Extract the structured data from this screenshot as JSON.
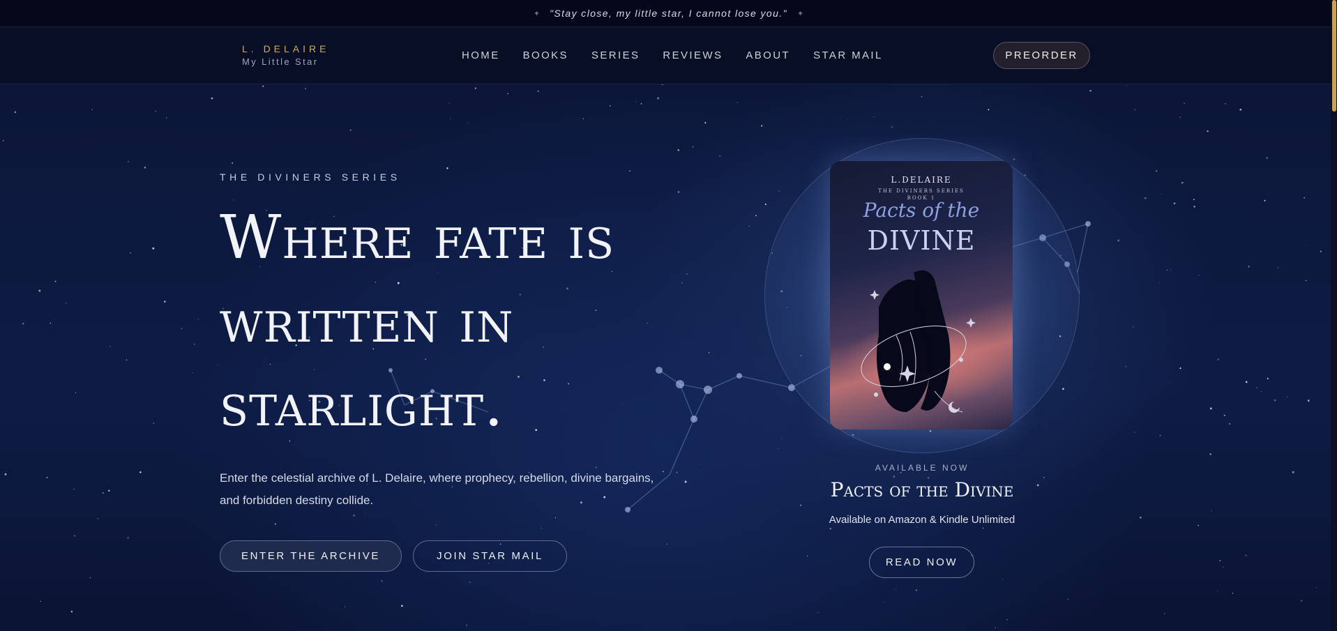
{
  "announcement": {
    "quote": "\"Stay close, my little star, I cannot lose you.\"",
    "spark_icon": "sparkle-icon"
  },
  "header": {
    "brand": "L. DELAIRE",
    "tagline": "My Little Star",
    "nav": [
      {
        "label": "HOME"
      },
      {
        "label": "BOOKS"
      },
      {
        "label": "SERIES"
      },
      {
        "label": "REVIEWS"
      },
      {
        "label": "ABOUT"
      },
      {
        "label": "STAR MAIL"
      }
    ],
    "preorder_label": "PREORDER"
  },
  "hero": {
    "eyebrow": "THE DIVINERS SERIES",
    "headline": "Where fate is written in starlight.",
    "lead": "Enter the celestial archive of L. Delaire, where prophecy, rebellion, divine bargains, and forbidden destiny collide.",
    "primary_cta": "ENTER THE ARCHIVE",
    "secondary_cta": "JOIN STAR MAIL"
  },
  "feature": {
    "cover": {
      "author": "L.DELAIRE",
      "series": "THE DIVINERS SERIES",
      "book_no": "BOOK 1",
      "title_line1": "Pacts of the",
      "title_line2": "DIVINE"
    },
    "availability": "AVAILABLE NOW",
    "title": "Pacts of the Divine",
    "note": "Available on Amazon & Kindle Unlimited",
    "cta": "READ NOW"
  },
  "colors": {
    "accent_gold": "#d4a85c",
    "background_navy": "#0a1330"
  }
}
